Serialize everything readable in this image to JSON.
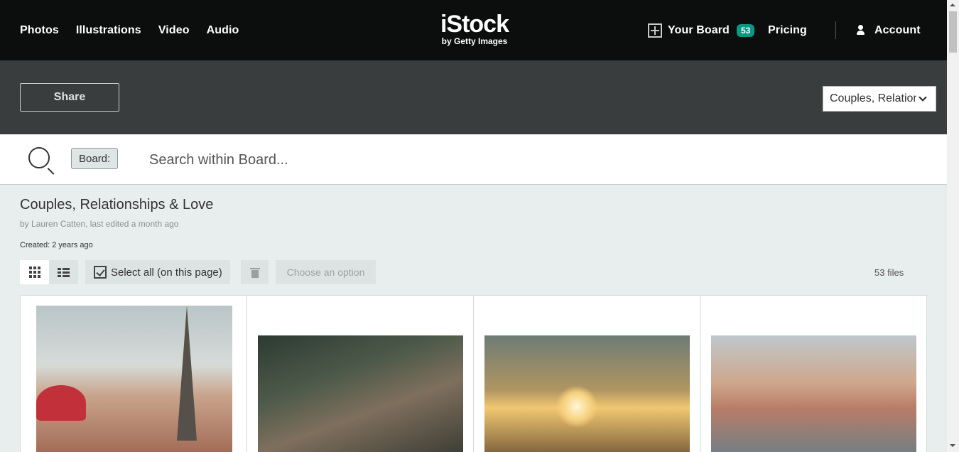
{
  "nav": {
    "links": [
      "Photos",
      "Illustrations",
      "Video",
      "Audio"
    ],
    "logo_main": "iStock",
    "logo_sub": "by Getty Images",
    "your_board_label": "Your Board",
    "your_board_count": "53",
    "pricing_label": "Pricing",
    "account_label": "Account"
  },
  "band": {
    "share_label": "Share",
    "board_select_value": "Couples, Relationships & Love"
  },
  "search": {
    "chip_label": "Board:",
    "placeholder": "Search within Board..."
  },
  "board": {
    "title": "Couples, Relationships & Love",
    "byline": "by Lauren Catten, last edited a month ago",
    "created": "Created: 2 years ago"
  },
  "toolbar": {
    "select_all_label": "Select all (on this page)",
    "choose_option_label": "Choose an option",
    "file_count": "53 files"
  },
  "images": [
    {
      "alt": "Couple selfie in front of Eiffel Tower"
    },
    {
      "alt": "Couple taking selfie in cafe"
    },
    {
      "alt": "Man lifting woman in sea at sunset"
    },
    {
      "alt": "Couple selfie at harbor"
    }
  ],
  "colors": {
    "nav_bg": "#0c0d0d",
    "band_bg": "#3a3d3e",
    "page_bg": "#e8eded",
    "badge": "#0a9882"
  }
}
